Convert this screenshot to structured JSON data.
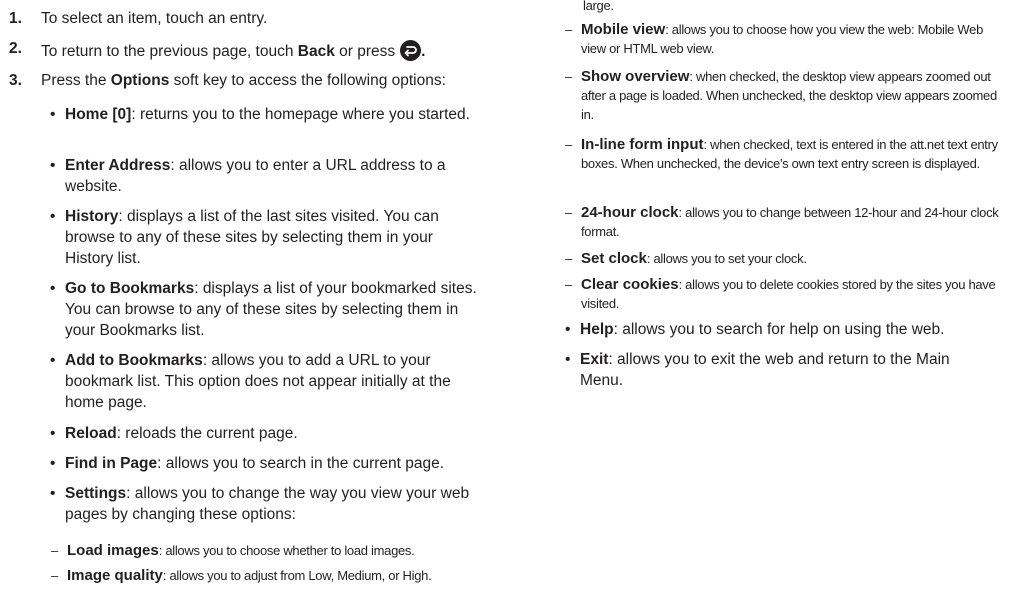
{
  "steps": [
    {
      "num": "1.",
      "text": "To select an item, touch an entry."
    },
    {
      "num": "2.",
      "text_before": "To return to the previous page, touch ",
      "bold": "Back",
      "text_mid": " or press",
      "text_after": "."
    },
    {
      "num": "3.",
      "text_before": "Press the ",
      "bold": "Options",
      "text_after": " soft key to access the following options:"
    }
  ],
  "options": [
    {
      "label": "Home [0]",
      "desc": ": returns you to the homepage where you started."
    },
    {
      "label": "Enter Address",
      "desc": ": allows you to enter a URL address to a website."
    },
    {
      "label": "History",
      "desc": ": displays a list of the last sites visited. You can browse to any of these sites by selecting them in your History list."
    },
    {
      "label": "Go to Bookmarks",
      "desc": ": displays a list of your bookmarked sites. You can browse to any of these sites by selecting them in your Bookmarks list."
    },
    {
      "label": "Add to Bookmarks",
      "desc": ": allows you to add a URL to your bookmark list. This option does not appear initially at the home page."
    },
    {
      "label": "Reload",
      "desc": ": reloads the current page."
    },
    {
      "label": "Find in Page",
      "desc": ": allows you to search in the current page."
    },
    {
      "label": "Settings",
      "desc": ": allows you to change the way you view your web pages by changing these options:"
    }
  ],
  "settings_left": [
    {
      "label": "Load images",
      "desc": ": allows you to choose whether to load images."
    },
    {
      "label": "Image quality",
      "desc": ": allows you to adjust from Low, Medium, or High."
    }
  ],
  "right_top_fragment": "large.",
  "settings_right": [
    {
      "label": "Mobile view",
      "desc": ": allows you to choose how you view the web: Mobile Web view or HTML web view."
    },
    {
      "label": "Show overview",
      "desc": ": when checked, the desktop view appears zoomed out after a page is loaded. When unchecked, the desktop view appears zoomed in."
    },
    {
      "label": "In-line form input",
      "desc": ": when checked, text is entered in the att.net text entry boxes. When unchecked, the device's own text entry screen is displayed."
    },
    {
      "label": "24-hour clock",
      "desc": ": allows you to change between 12-hour and 24-hour clock format."
    },
    {
      "label": "Set clock",
      "desc": ": allows you to set your clock."
    },
    {
      "label": "Clear cookies",
      "desc": ": allows you to delete cookies stored by the sites you have visited."
    }
  ],
  "options_right": [
    {
      "label": "Help",
      "desc": ": allows you to search for help on using the web."
    },
    {
      "label": "Exit",
      "desc": ": allows you to exit the web and return to the Main Menu."
    }
  ],
  "symbols": {
    "bullet": "•",
    "dash": "–"
  }
}
